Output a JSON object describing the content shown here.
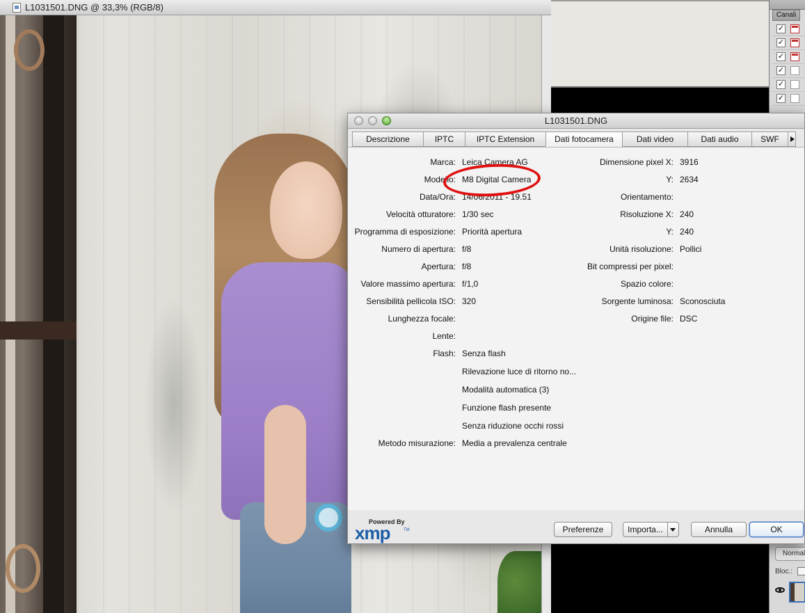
{
  "document": {
    "title": "L1031501.DNG @ 33,3% (RGB/8)"
  },
  "channels_panel": {
    "tab": "Canali"
  },
  "layers_panel": {
    "blend_mode": "Normale",
    "lock_label": "Bloc.:"
  },
  "dialog": {
    "title": "L1031501.DNG",
    "tabs": [
      {
        "label": "Descrizione",
        "active": false
      },
      {
        "label": "IPTC",
        "active": false
      },
      {
        "label": "IPTC Extension",
        "active": false
      },
      {
        "label": "Dati fotocamera",
        "active": true
      },
      {
        "label": "Dati video",
        "active": false
      },
      {
        "label": "Dati audio",
        "active": false
      },
      {
        "label": "SWF",
        "active": false
      }
    ],
    "left_fields": [
      {
        "label": "Marca:",
        "value": "Leica Camera AG"
      },
      {
        "label": "Modello:",
        "value": "M8 Digital Camera"
      },
      {
        "label": "Data/Ora:",
        "value": "14/06/2011 - 19.51"
      },
      {
        "label": "Velocità otturatore:",
        "value": "1/30 sec"
      },
      {
        "label": "Programma di esposizione:",
        "value": "Priorità apertura"
      },
      {
        "label": "Numero di apertura:",
        "value": "f/8"
      },
      {
        "label": "Apertura:",
        "value": "f/8"
      },
      {
        "label": "Valore massimo apertura:",
        "value": "f/1,0"
      },
      {
        "label": "Sensibilità pellicola ISO:",
        "value": "320"
      },
      {
        "label": "Lunghezza focale:",
        "value": ""
      },
      {
        "label": "Lente:",
        "value": ""
      },
      {
        "label": "Flash:",
        "value": "Senza flash"
      }
    ],
    "flash_details": [
      "Rilevazione luce di ritorno no...",
      "Modalità automatica (3)",
      "Funzione flash presente",
      "Senza riduzione occhi rossi"
    ],
    "metering": {
      "label": "Metodo misurazione:",
      "value": "Media a prevalenza centrale"
    },
    "right_fields": [
      {
        "label": "Dimensione pixel X:",
        "value": "3916"
      },
      {
        "label": "Y:",
        "value": "2634"
      },
      {
        "label": "Orientamento:",
        "value": ""
      },
      {
        "label": "Risoluzione X:",
        "value": "240"
      },
      {
        "label": "Y:",
        "value": "240"
      },
      {
        "label": "Unità risoluzione:",
        "value": "Pollici"
      },
      {
        "label": "Bit compressi per pixel:",
        "value": ""
      },
      {
        "label": "Spazio colore:",
        "value": ""
      },
      {
        "label": "Sorgente luminosa:",
        "value": "Sconosciuta"
      },
      {
        "label": "Origine file:",
        "value": "DSC"
      }
    ],
    "logo": {
      "powered_by": "Powered By",
      "word": "xmp",
      "tm": "TM"
    },
    "buttons": {
      "preferences": "Preferenze",
      "import": "Importa...",
      "cancel": "Annulla",
      "ok": "OK"
    }
  },
  "colors": {
    "annotation": "#e01010",
    "xmp_blue": "#1d5fa8",
    "default_button": "#4f7cc0"
  }
}
